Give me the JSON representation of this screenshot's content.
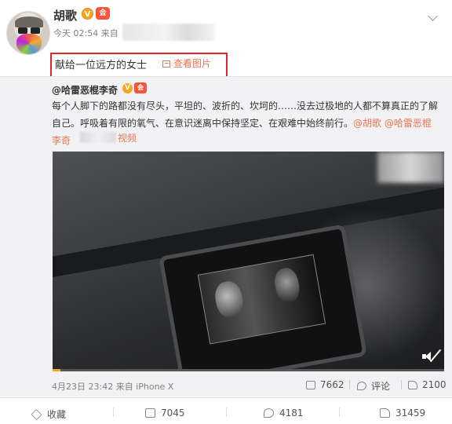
{
  "post": {
    "author": "胡歌",
    "verified_mark": "V",
    "vip_mark": "会",
    "time_source": "今天 02:54 来自",
    "text": "献给一位远方的女士",
    "view_image_label": "查看图片"
  },
  "repost": {
    "author": "@哈雷恶棍李奇",
    "verified_mark": "V",
    "vip_mark": "会",
    "body_text": "每个人脚下的路都没有尽头，平坦的、波折的、坎坷的……没去过极地的人都不算真正的了解自己。呼吸着有限的氧气、在意识迷离中保持坚定、在艰难中始终前行。",
    "mention_1": "@胡歌",
    "mention_2": "@哈雷恶棍",
    "mention_3": "李奇",
    "video_link": "视频",
    "meta": "4月23日 23:42 来自 iPhone X",
    "forwards": "7662",
    "comment_label": "评论",
    "likes": "2100",
    "video_progress": 0.02
  },
  "actions": {
    "favorite_label": "收藏",
    "forwards": "7045",
    "comments": "4181",
    "likes": "31459"
  },
  "colors": {
    "accent": "#eb7350",
    "highlight_border": "#e5232b",
    "verified": "#f7a71b"
  }
}
